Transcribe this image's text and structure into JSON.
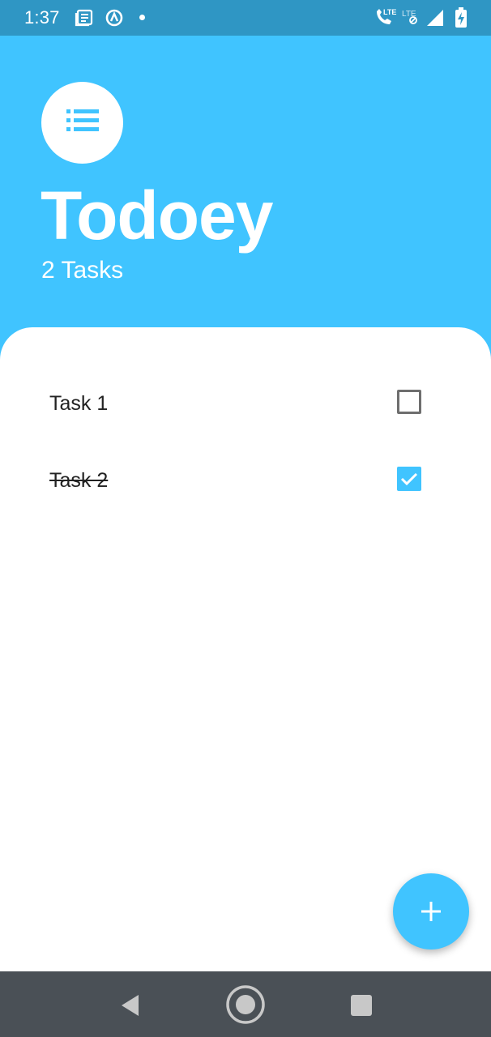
{
  "status_bar": {
    "time": "1:37",
    "icons": [
      "news-icon",
      "data-saver-icon",
      "notification-dot-icon",
      "volte-call-icon",
      "lte-signal-icon",
      "cell-signal-icon",
      "battery-charging-icon"
    ],
    "lte_label": "LTE",
    "lte2_label": "LTE"
  },
  "header": {
    "avatar_icon": "list-icon",
    "title": "Todoey",
    "task_count": "2 Tasks"
  },
  "tasks": [
    {
      "label": "Task 1",
      "done": false
    },
    {
      "label": "Task 2",
      "done": true
    }
  ],
  "fab": {
    "icon": "plus-icon"
  },
  "nav_bar": {
    "icons": [
      "back-icon",
      "home-icon",
      "recents-icon"
    ]
  },
  "colors": {
    "accent": "#40c4ff",
    "status_bar": "#2f96c4",
    "nav_bar": "#4a5056",
    "checkbox_border": "#6e6e6e"
  }
}
